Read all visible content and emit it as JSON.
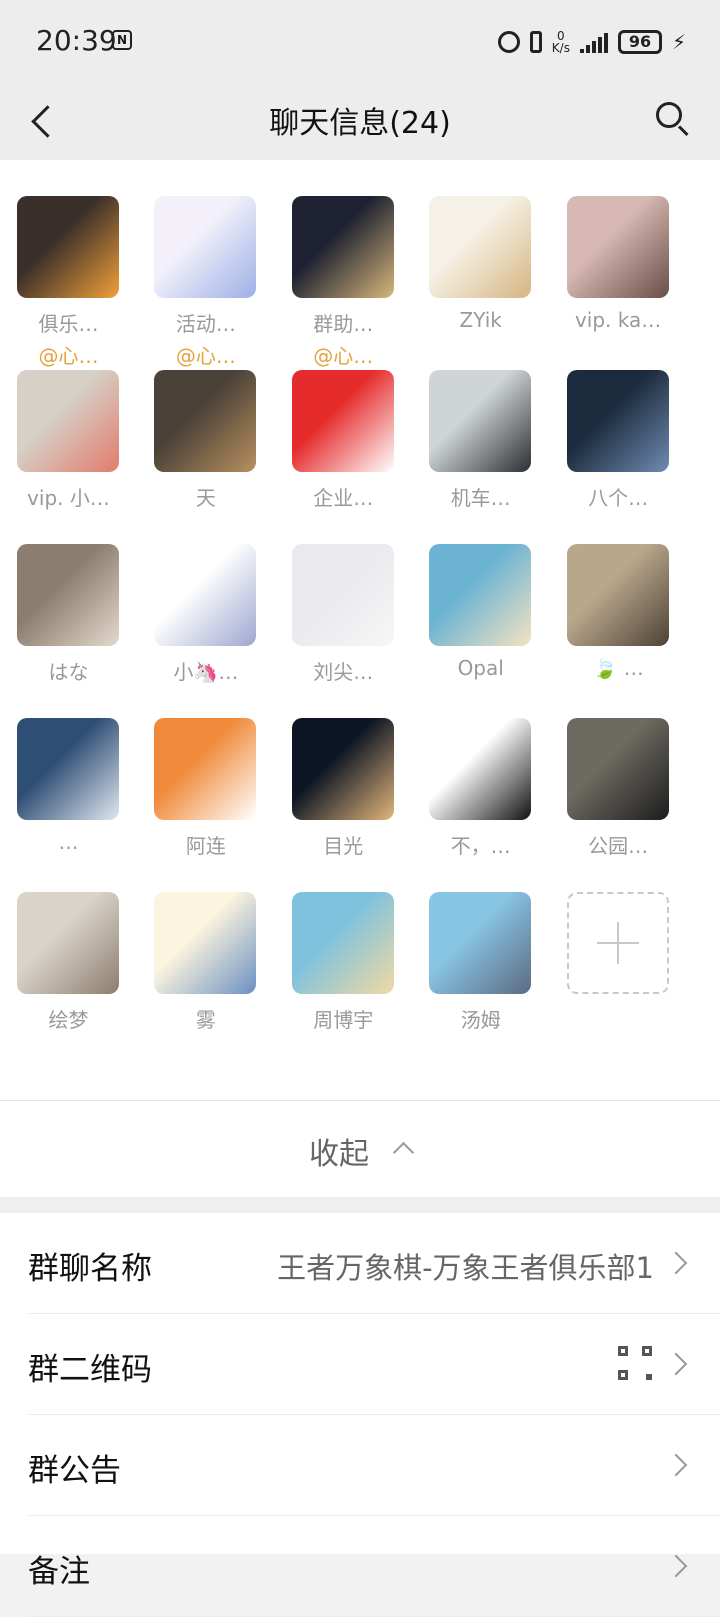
{
  "status_bar": {
    "time": "20:39",
    "nfc": "N",
    "net_speed_top": "0",
    "net_speed_unit": "K/s",
    "battery": "96"
  },
  "nav": {
    "title": "聊天信息(24)"
  },
  "members": [
    {
      "name": "俱乐…",
      "tag": "@心…",
      "palette": [
        "#3a2f2a",
        "#f2a03a"
      ]
    },
    {
      "name": "活动…",
      "tag": "@心…",
      "palette": [
        "#f3f0fa",
        "#9db0e6"
      ]
    },
    {
      "name": "群助…",
      "tag": "@心…",
      "palette": [
        "#1e2233",
        "#d9b77a"
      ]
    },
    {
      "name": "ZYik",
      "tag": "",
      "palette": [
        "#f6f1e6",
        "#d6b581"
      ]
    },
    {
      "name": "vip. ka…",
      "tag": "",
      "palette": [
        "#d7b8b2",
        "#6a4e47"
      ]
    },
    {
      "name": "vip. 小…",
      "tag": "",
      "palette": [
        "#d6d0c7",
        "#e27b6b"
      ]
    },
    {
      "name": "天",
      "tag": "",
      "palette": [
        "#4a4138",
        "#b8905e"
      ]
    },
    {
      "name": "企业…",
      "tag": "",
      "palette": [
        "#e52b2b",
        "#ffffff"
      ]
    },
    {
      "name": "机车…",
      "tag": "",
      "palette": [
        "#cfd4d6",
        "#2c2f33"
      ]
    },
    {
      "name": "八个…",
      "tag": "",
      "palette": [
        "#1b2a3c",
        "#6f8bb0"
      ]
    },
    {
      "name": "はな",
      "tag": "",
      "palette": [
        "#8b7d6f",
        "#e4d9cd"
      ]
    },
    {
      "name": "小🦄…",
      "tag": "",
      "palette": [
        "#ffffff",
        "#9ea6cf"
      ]
    },
    {
      "name": "刘尖…",
      "tag": "",
      "palette": [
        "#e9e9ee",
        "#f7f7f7"
      ]
    },
    {
      "name": "Opal",
      "tag": "",
      "palette": [
        "#6cb3d4",
        "#f4e3c1"
      ]
    },
    {
      "name": "🍃 …",
      "tag": "",
      "palette": [
        "#b9a78c",
        "#4d4236"
      ]
    },
    {
      "name": "…",
      "tag": "",
      "palette": [
        "#2f4e74",
        "#dfe8f0"
      ]
    },
    {
      "name": "阿连",
      "tag": "",
      "palette": [
        "#f0893a",
        "#ffffff"
      ]
    },
    {
      "name": "目光",
      "tag": "",
      "palette": [
        "#0d1524",
        "#e3b67a"
      ]
    },
    {
      "name": "不，…",
      "tag": "",
      "palette": [
        "#ffffff",
        "#111111"
      ]
    },
    {
      "name": "公园…",
      "tag": "",
      "palette": [
        "#6d6a61",
        "#1c1c1c"
      ]
    },
    {
      "name": "绘梦",
      "tag": "",
      "palette": [
        "#d9d3ca",
        "#8c7e6d"
      ]
    },
    {
      "name": "雾",
      "tag": "",
      "palette": [
        "#fbf5df",
        "#6a8fc2"
      ]
    },
    {
      "name": "周博宇",
      "tag": "",
      "palette": [
        "#7ec2df",
        "#f1d9a3"
      ]
    },
    {
      "name": "汤姆",
      "tag": "",
      "palette": [
        "#88c4e3",
        "#5c6b82"
      ]
    }
  ],
  "collapse_label": "收起",
  "settings": [
    {
      "label": "群聊名称",
      "value": "王者万象棋-万象王者俱乐部1"
    },
    {
      "label": "群二维码",
      "value": ""
    },
    {
      "label": "群公告",
      "value": ""
    },
    {
      "label": "备注",
      "value": ""
    }
  ]
}
